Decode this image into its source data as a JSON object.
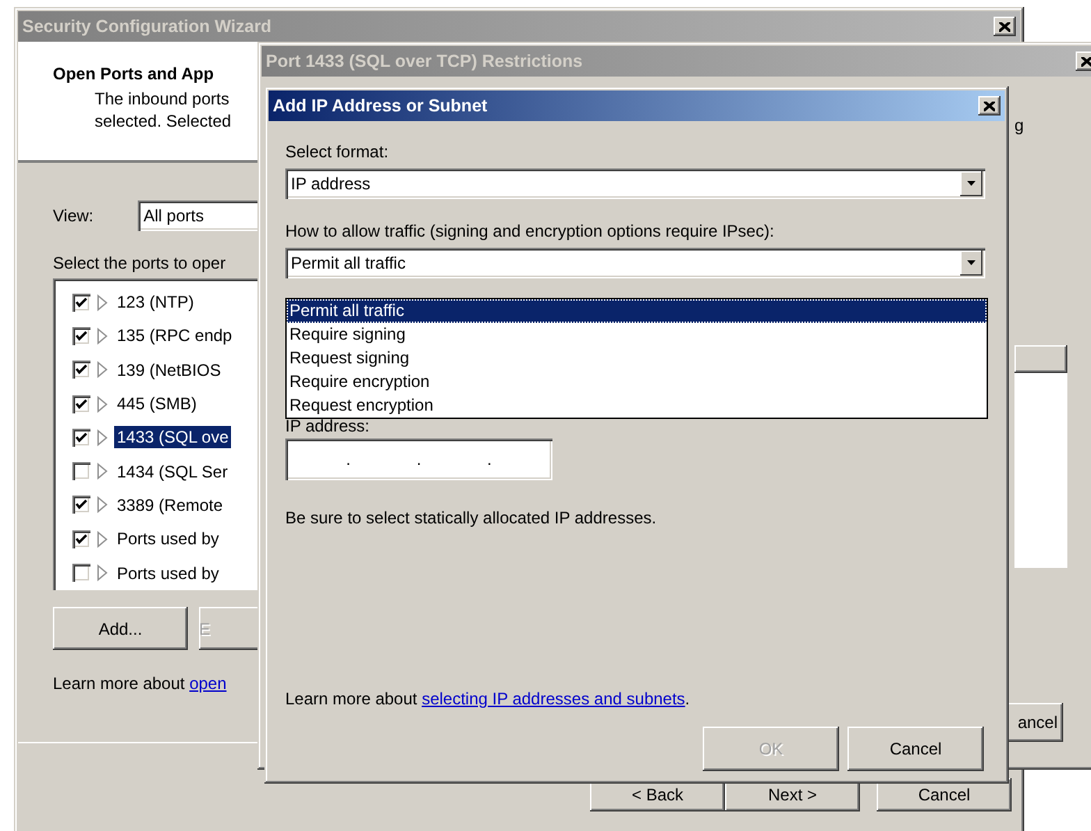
{
  "wizard": {
    "title": "Security Configuration Wizard",
    "active": false,
    "heading": "Open Ports and App",
    "description_lines": [
      "The inbound ports",
      "selected. Selected"
    ],
    "view_label": "View:",
    "view_value": "All ports",
    "ports_label": "Select the ports to oper",
    "ports": [
      {
        "label": "123 (NTP)",
        "checked": true,
        "selected": false
      },
      {
        "label": "135 (RPC endp",
        "checked": true,
        "selected": false
      },
      {
        "label": "139 (NetBIOS",
        "checked": true,
        "selected": false
      },
      {
        "label": "445 (SMB)",
        "checked": true,
        "selected": false
      },
      {
        "label": "1433 (SQL ove",
        "checked": true,
        "selected": true
      },
      {
        "label": "1434 (SQL Ser",
        "checked": false,
        "selected": false
      },
      {
        "label": "3389 (Remote",
        "checked": true,
        "selected": false
      },
      {
        "label": "Ports used by",
        "checked": true,
        "selected": false
      },
      {
        "label": "Ports used by",
        "checked": false,
        "selected": false
      }
    ],
    "list_buttons": [
      {
        "label": "Add...",
        "disabled": false
      },
      {
        "label": "E",
        "disabled": true
      }
    ],
    "learn_more": {
      "text": "Learn more about ",
      "link": "open"
    },
    "nav_buttons": [
      {
        "label": "< Back",
        "disabled": false
      },
      {
        "label": "Next >",
        "disabled": false
      },
      {
        "label": "Cancel",
        "disabled": false
      }
    ]
  },
  "restrictions_window": {
    "title": "Port 1433 (SQL over TCP) Restrictions",
    "active": false,
    "text_fragment": "g",
    "button": "ancel"
  },
  "add_dialog": {
    "title": "Add IP Address or Subnet",
    "active": true,
    "format_label": "Select format:",
    "format_value": "IP address",
    "traffic_label": "How to allow traffic (signing and encryption options require IPsec):",
    "traffic_value": "Permit all traffic",
    "traffic_options": [
      {
        "label": "Permit all traffic",
        "selected": true
      },
      {
        "label": "Require signing",
        "selected": false
      },
      {
        "label": "Request signing",
        "selected": false
      },
      {
        "label": "Require encryption",
        "selected": false
      },
      {
        "label": "Request encryption",
        "selected": false
      }
    ],
    "ip_label": "IP address:",
    "ip_separators": [
      ".",
      ".",
      "."
    ],
    "note": "Be sure to select statically allocated IP addresses.",
    "learn_more": {
      "text": "Learn more about ",
      "link": "selecting IP addresses and subnets",
      "after": "."
    },
    "buttons": [
      {
        "label": "OK",
        "disabled": true
      },
      {
        "label": "Cancel",
        "disabled": false
      }
    ]
  }
}
